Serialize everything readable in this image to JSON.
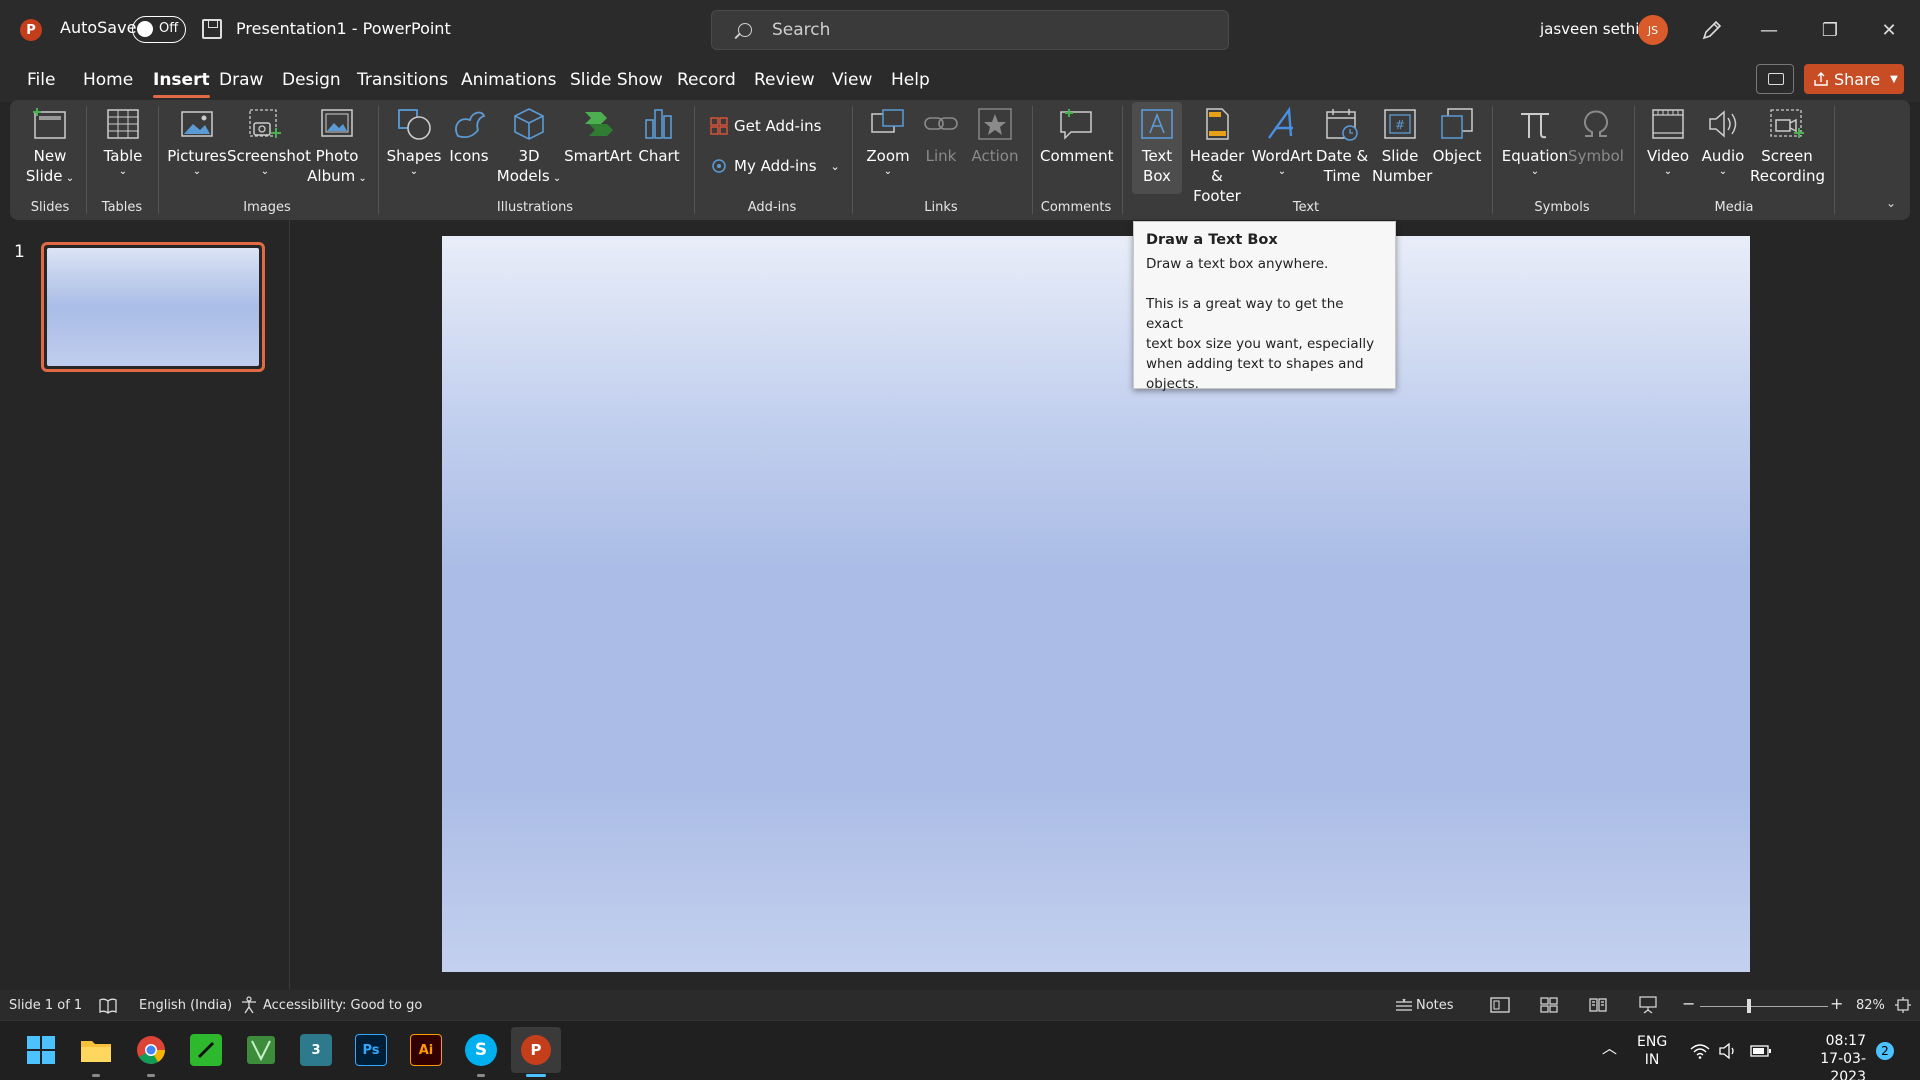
{
  "titlebar": {
    "app_logo": "P",
    "autosave_label": "AutoSave",
    "autosave_state": "Off",
    "document_title": "Presentation1  -  PowerPoint",
    "search_placeholder": "Search",
    "user_name": "jasveen sethi",
    "user_initials": "JS",
    "minimize": "—",
    "restore": "❐",
    "close": "✕"
  },
  "menu": {
    "tabs": [
      "File",
      "Home",
      "Insert",
      "Draw",
      "Design",
      "Transitions",
      "Animations",
      "Slide Show",
      "Record",
      "Review",
      "View",
      "Help"
    ],
    "active_tab": "Insert",
    "share_label": "Share"
  },
  "ribbon": {
    "new_slide": [
      "New",
      "Slide"
    ],
    "table": "Table",
    "pictures": "Pictures",
    "screenshot": "Screenshot",
    "photo_album": [
      "Photo",
      "Album"
    ],
    "shapes": "Shapes",
    "icons": "Icons",
    "models_3d": [
      "3D",
      "Models"
    ],
    "smartart": "SmartArt",
    "chart": "Chart",
    "get_addins": "Get Add-ins",
    "my_addins": "My Add-ins",
    "zoom": "Zoom",
    "link": "Link",
    "action": "Action",
    "comment": "Comment",
    "text_box": [
      "Text",
      "Box"
    ],
    "header_footer": [
      "Header",
      "& Footer"
    ],
    "wordart": "WordArt",
    "date_time": [
      "Date &",
      "Time"
    ],
    "slide_number": [
      "Slide",
      "Number"
    ],
    "object": "Object",
    "equation": "Equation",
    "symbol": "Symbol",
    "video": "Video",
    "audio": "Audio",
    "screen_recording": [
      "Screen",
      "Recording"
    ],
    "groups": {
      "slides": "Slides",
      "tables": "Tables",
      "images": "Images",
      "illustrations": "Illustrations",
      "addins": "Add-ins",
      "links": "Links",
      "comments": "Comments",
      "text": "Text",
      "symbols": "Symbols",
      "media": "Media"
    }
  },
  "tooltip": {
    "title": "Draw a Text Box",
    "line1": "Draw a text box anywhere.",
    "para": [
      "This is a great way to get the exact",
      "text box size you want, especially",
      "when adding text to shapes and",
      "objects."
    ]
  },
  "slides_pane": {
    "slide_number": "1"
  },
  "statusbar": {
    "slide_info": "Slide 1 of 1",
    "language": "English (India)",
    "accessibility": "Accessibility: Good to go",
    "notes": "Notes",
    "zoom_level": "82%"
  },
  "taskbar": {
    "apps": [
      "Start",
      "File Explorer",
      "Chrome",
      "App",
      "App",
      "3ds Max",
      "Photoshop",
      "Illustrator",
      "Skype",
      "PowerPoint"
    ],
    "max_label": "3",
    "ps_label": "Ps",
    "ai_label": "Ai",
    "skype_label": "S",
    "ppt_label": "P",
    "lang1": "ENG",
    "lang2": "IN",
    "time": "08:17",
    "date": "17-03-2023",
    "notif_count": "2"
  },
  "colors": {
    "accent": "#e06a44",
    "share": "#c84d25",
    "ribbon_bg": "#3b3b3b",
    "slide_top": "#e8edf8",
    "slide_mid": "#abbde6"
  }
}
